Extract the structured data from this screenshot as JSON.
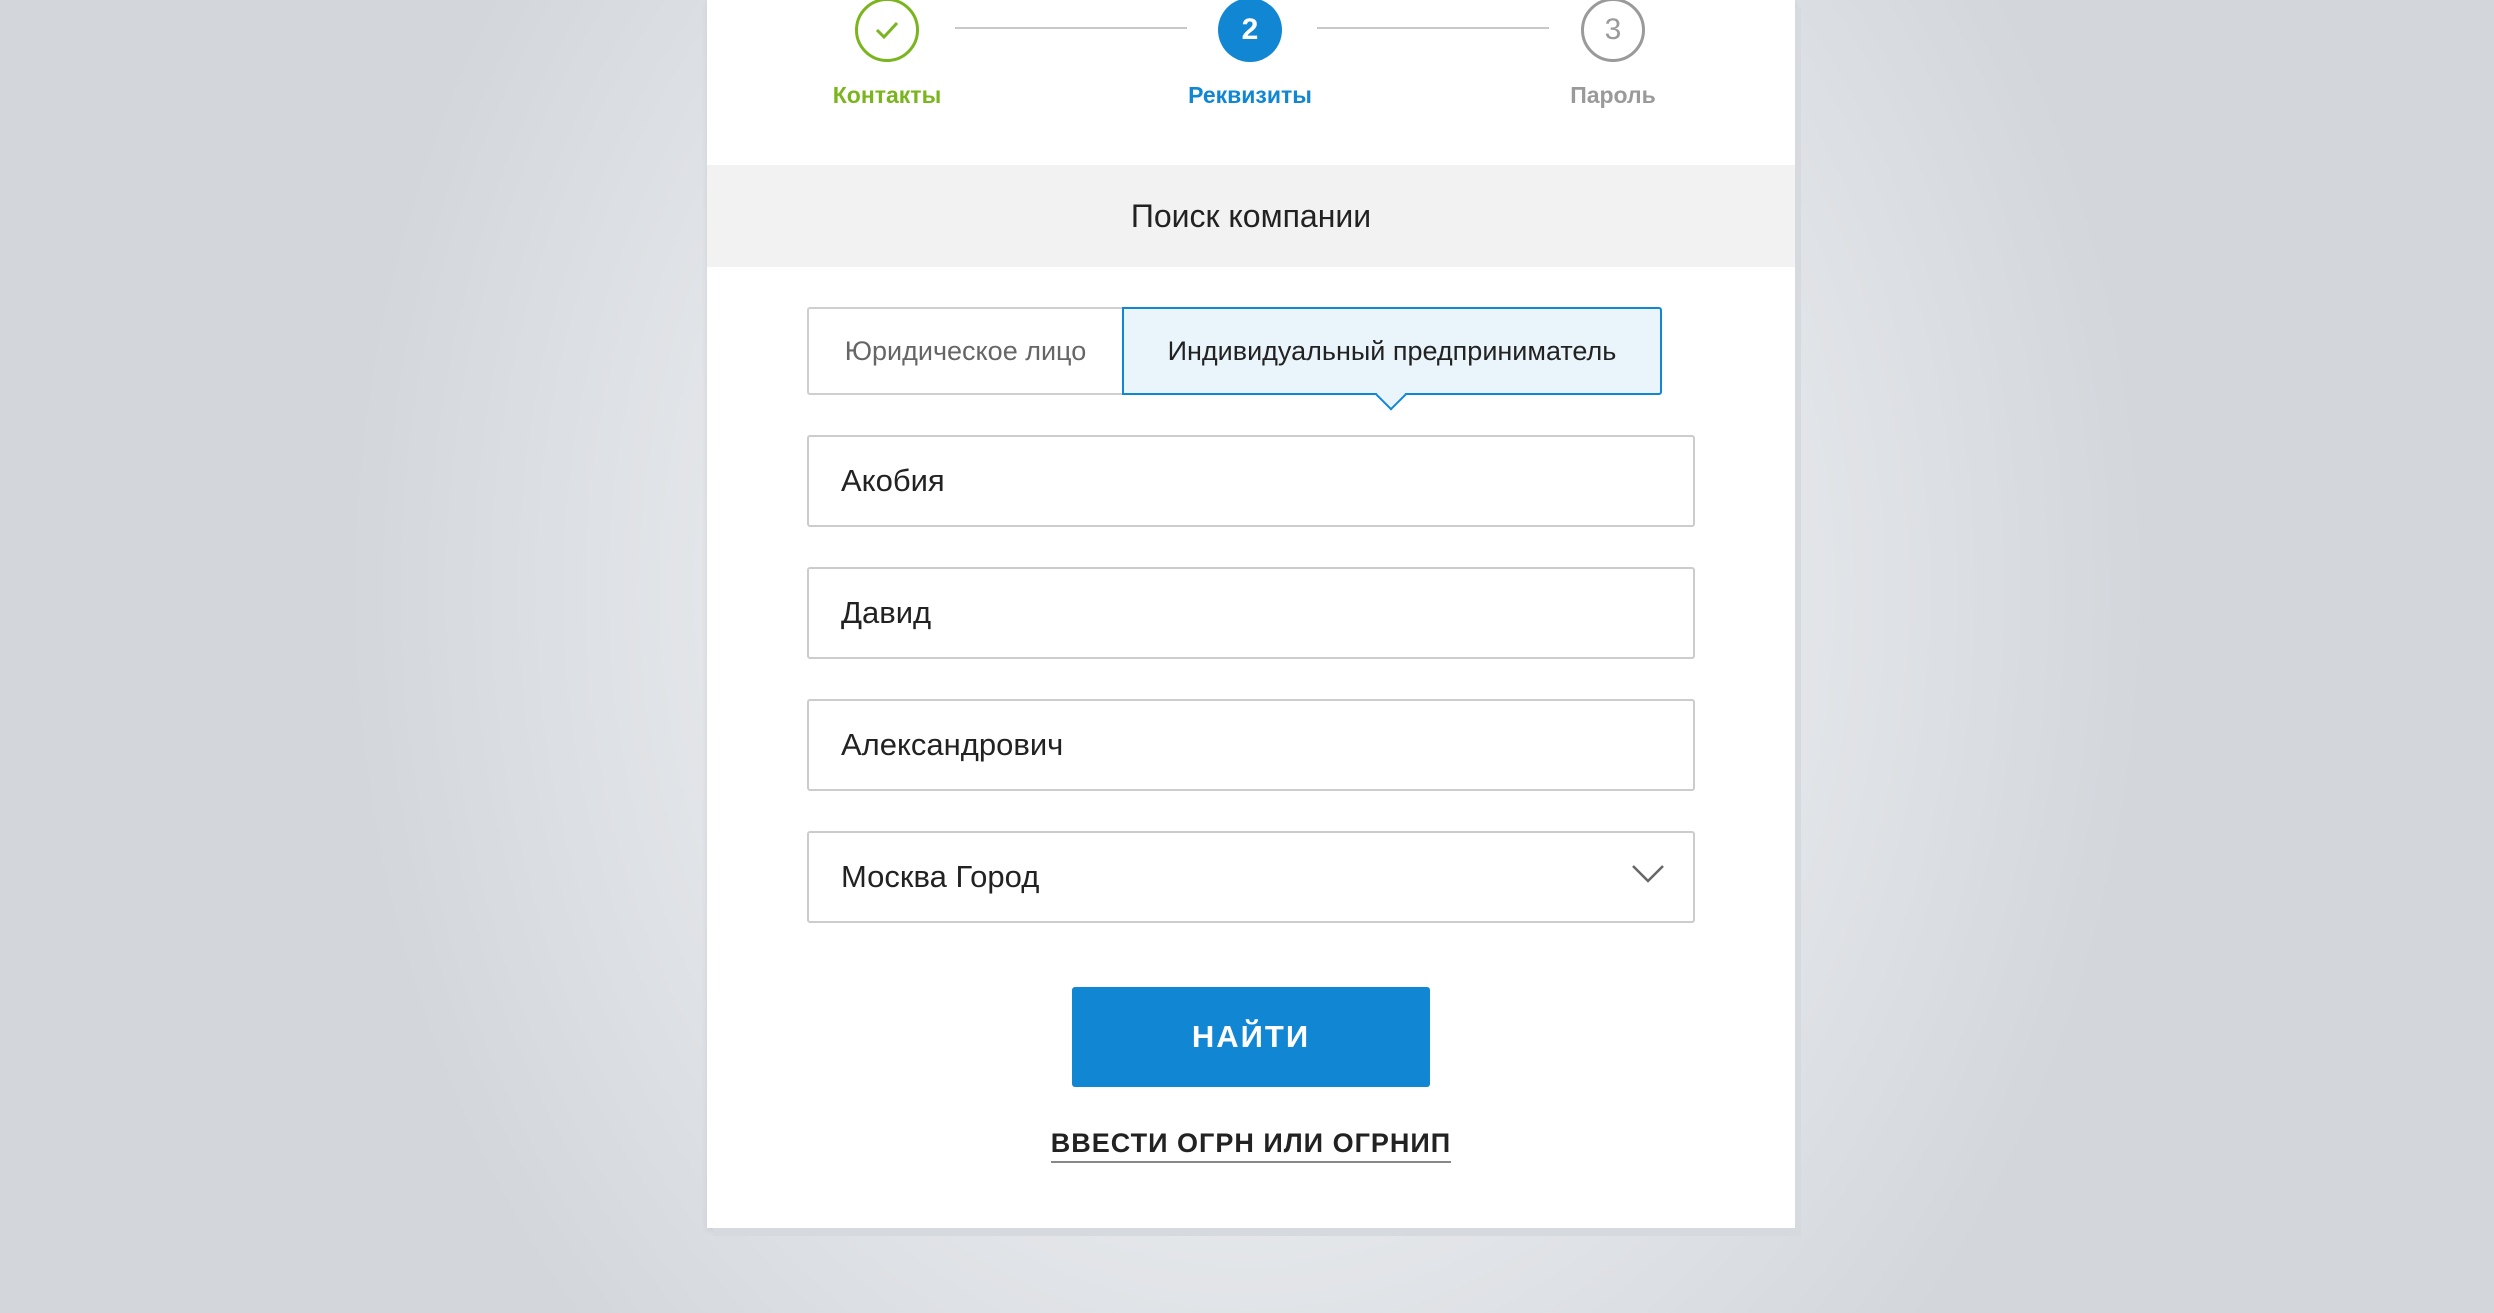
{
  "stepper": {
    "steps": [
      {
        "label": "Контакты",
        "state": "done"
      },
      {
        "label": "Реквизиты",
        "state": "active",
        "number": "2"
      },
      {
        "label": "Пароль",
        "state": "todo",
        "number": "3"
      }
    ]
  },
  "section": {
    "title": "Поиск компании"
  },
  "entity_toggle": {
    "options": [
      "Юридическое лицо",
      "Индивидуальный предприниматель"
    ],
    "selected": "Индивидуальный предприниматель"
  },
  "form": {
    "last_name": "Акобия",
    "first_name": "Давид",
    "middle_name": "Александрович",
    "region": "Москва Город"
  },
  "actions": {
    "submit_label": "НАЙТИ",
    "alt_link_label": "ВВЕСТИ ОГРН ИЛИ ОГРНИП"
  },
  "colors": {
    "accent": "#1187d4",
    "success": "#7ab51d",
    "inactive": "#9a9a9a"
  }
}
